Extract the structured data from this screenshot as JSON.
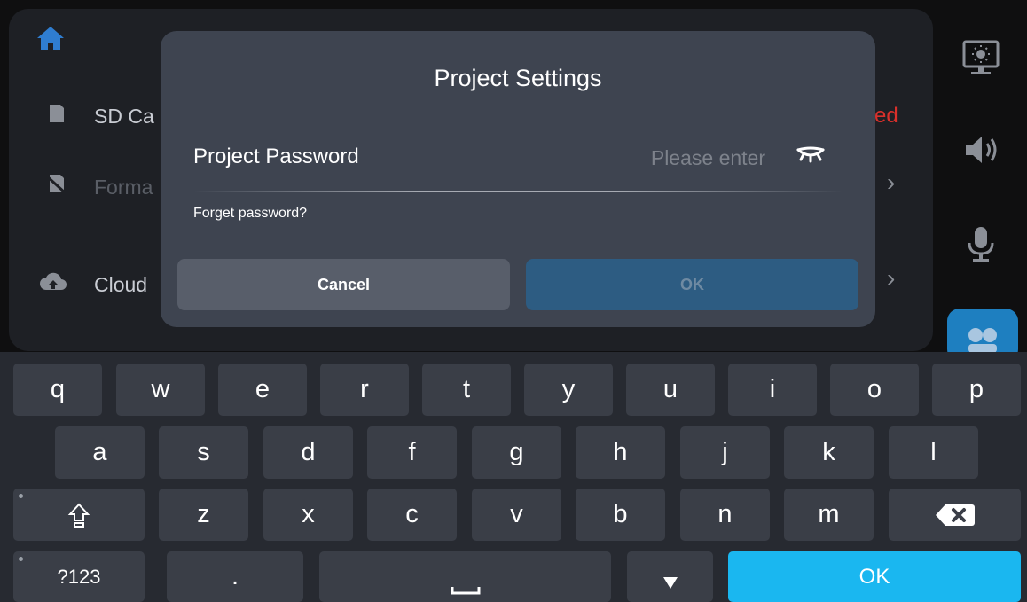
{
  "background_panel": {
    "rows": [
      {
        "icon": "sd-card-icon",
        "label": "SD Ca"
      },
      {
        "icon": "format-icon",
        "label": "Forma"
      },
      {
        "icon": "cloud-upload-icon",
        "label": "Cloud"
      }
    ],
    "status_partial": "ed"
  },
  "sidebar": {
    "icons": [
      "display-settings-icon",
      "speaker-icon",
      "microphone-icon",
      "layout-icon"
    ]
  },
  "dialog": {
    "title": "Project Settings",
    "password_label": "Project Password",
    "password_value": "",
    "password_placeholder": "Please enter",
    "eye_icon": "eye-closed-icon",
    "forget_link": "Forget password?",
    "cancel_label": "Cancel",
    "ok_label": "OK"
  },
  "keyboard": {
    "row1": [
      "q",
      "w",
      "e",
      "r",
      "t",
      "y",
      "u",
      "i",
      "o",
      "p"
    ],
    "row2": [
      "a",
      "s",
      "d",
      "f",
      "g",
      "h",
      "j",
      "k",
      "l"
    ],
    "row3": [
      "z",
      "x",
      "c",
      "v",
      "b",
      "n",
      "m"
    ],
    "shift_icon": "shift-icon",
    "backspace_icon": "backspace-icon",
    "symbols_label": "?123",
    "period_label": ".",
    "space_icon": "space-bar-icon",
    "hide_icon": "hide-keyboard-icon",
    "ok_label": "OK"
  },
  "colors": {
    "dialog_bg": "#3e4450",
    "ok_disabled": "#2d5c82",
    "keyboard_ok": "#1ab7f0",
    "keyboard_bg": "#272a31",
    "key_bg": "#3a3e47",
    "sidebar_active": "#1e7fc0"
  }
}
